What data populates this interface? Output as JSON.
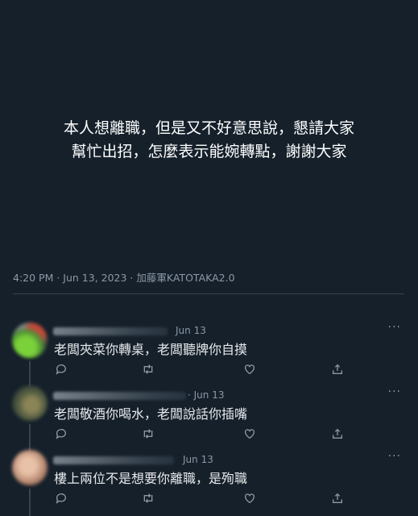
{
  "post": {
    "text_lines": [
      "本人想離職，但是又不好意思說，懇請大家",
      "幫忙出招，怎麼表示能婉轉點，謝謝大家"
    ],
    "meta": "4:20 PM · Jun 13, 2023 · 加藤軍KATOTAKA2.0"
  },
  "replies": [
    {
      "date": "Jun 13",
      "text": "老闆夾菜你轉桌，老闆聽牌你自摸",
      "more": "···"
    },
    {
      "date": "· Jun 13",
      "text": "老闆敬酒你喝水，老闆說話你插嘴",
      "more": "···"
    },
    {
      "date": "Jun 13",
      "text": "樓上兩位不是想要你離職，是殉職",
      "more": "···"
    }
  ],
  "icons": [
    "reply-icon",
    "retweet-icon",
    "like-icon",
    "share-icon",
    "more-icon"
  ],
  "colors": {
    "background": "#15202b",
    "text": "#e7e9ea",
    "secondary": "#8b98a5",
    "divider": "#38444d"
  }
}
